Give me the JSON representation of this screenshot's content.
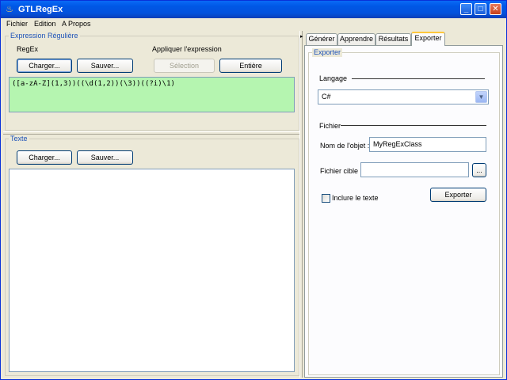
{
  "window": {
    "title": "GTLRegEx",
    "app_icon": "java-cup-icon",
    "controls": {
      "minimize": "_",
      "maximize": "□",
      "close": "✕"
    }
  },
  "menubar": {
    "items": [
      {
        "label": "Fichier"
      },
      {
        "label": "Edition"
      },
      {
        "label": "A Propos"
      }
    ]
  },
  "regex_panel": {
    "title": "Expression Régulière",
    "regex_label": "RegEx",
    "load_label": "Charger...",
    "save_label": "Sauver...",
    "apply_label": "Appliquer l'expression",
    "selection_label": "Sélection",
    "entire_label": "Entière",
    "expression": "([a-zA-Z](1,3))((\\d(1,2))(\\3))((?i)\\1)",
    "area_color": "#b5f5b0"
  },
  "text_panel": {
    "title": "Texte",
    "load_label": "Charger...",
    "save_label": "Sauver...",
    "content": ""
  },
  "tabs": [
    {
      "label": "Générer",
      "active": false
    },
    {
      "label": "Apprendre",
      "active": false
    },
    {
      "label": "Résultats",
      "active": false
    },
    {
      "label": "Exporter",
      "active": true
    }
  ],
  "export_panel": {
    "title": "Exporter",
    "language_label": "Langage",
    "language_value": "C#",
    "file_section_label": "Fichier",
    "object_name_label": "Nom de l'objet :",
    "object_name_value": "MyRegExClass",
    "target_file_label": "Fichier cible :",
    "target_file_value": "",
    "browse_label": "...",
    "include_text_label": "Inclure le texte",
    "include_text_checked": false,
    "export_button_label": "Exporter"
  },
  "colors": {
    "title_bar": "#0058e6",
    "accent": "#1d52b8",
    "active_tab_highlight": "#ffc73c"
  }
}
